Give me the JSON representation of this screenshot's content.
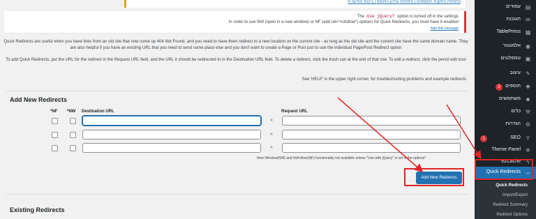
{
  "top_notice": {
    "links": "התחלת התקנת התוספים | התחלת עדכון התוסף | ביטול הודעה זו"
  },
  "info_notice": {
    "line1_before": "The",
    "line1_code": "Use jQuery?",
    "line1_after": "option is turned off in the settings",
    "line2": "In order to use NW (open in a new window) or NF (add rel=\"nofollow\") options for Quick Redirects, you must have it enabled",
    "hide_link": "hide this message"
  },
  "paragraphs": {
    "p1": "Quick Redirects are useful when you have links from an old site that now come up 404 Not Found, and you need to have them redirect to a new location on the current site - as long as the old site and the current site have the same domain name. They are also helpful if you have an existing URL that you need to send some place else and you don't want to create a Page or Post just to use the individual Page/Post Redirect option",
    "p2": "To add Quick Redirects, put the URL for the redirect in the Request URL field, and the URL it should be redirected to in the Destination URL field. To delete a redirect, click the trash can at the end of that row. To edit a redirect, click the pencil edit icon",
    "p3": "See 'HELP' in the upper right corner, for troubleshooting problems and example redirects"
  },
  "add_section": {
    "title": "Add New Redirects",
    "col_nf": "*NF",
    "col_nw": "*NW",
    "col_destination": "Destination URL",
    "col_request": "Request URL",
    "arrow_glyph": "«",
    "note": "New Window(NW) and NoFollow(NF) functionality not available unless \"Use with jQuery\" is set in the options*",
    "button": "Add New Redirects",
    "rows": [
      {
        "destination": "",
        "request": ""
      },
      {
        "destination": "",
        "request": ""
      },
      {
        "destination": "",
        "request": ""
      }
    ]
  },
  "existing_section": {
    "title": "Existing Redirects"
  },
  "sidebar": {
    "items": [
      {
        "label": "עמודים",
        "icon": "pages-icon"
      },
      {
        "label": "תגובות",
        "icon": "comments-icon"
      },
      {
        "label": "TablePress",
        "icon": "table-icon"
      },
      {
        "label": "אלמנטור",
        "icon": "elementor-icon"
      },
      {
        "label": "טמפלטים",
        "icon": "templates-icon"
      },
      {
        "label": "עיצוב",
        "icon": "appearance-icon"
      },
      {
        "label": "תוספים",
        "icon": "plugins-icon",
        "badge": "2"
      },
      {
        "label": "משתמשים",
        "icon": "users-icon"
      },
      {
        "label": "כלים",
        "icon": "tools-icon"
      },
      {
        "label": "הגדרות",
        "icon": "settings-icon"
      },
      {
        "label": "SEO",
        "icon": "seo-icon",
        "badge": "1"
      },
      {
        "label": "Theme Panel",
        "icon": "gear-icon"
      },
      {
        "label": "ezCache",
        "icon": "bolt-icon"
      },
      {
        "label": "Quick Redirects",
        "icon": "redirect-icon"
      }
    ],
    "submenu": [
      "Quick Redirects",
      "Import/Export",
      "Redirect Summary",
      "Redirect Options"
    ]
  },
  "colors": {
    "accent": "#2271b1",
    "sidebar_bg": "#1d2327",
    "annotation": "#e02424"
  }
}
